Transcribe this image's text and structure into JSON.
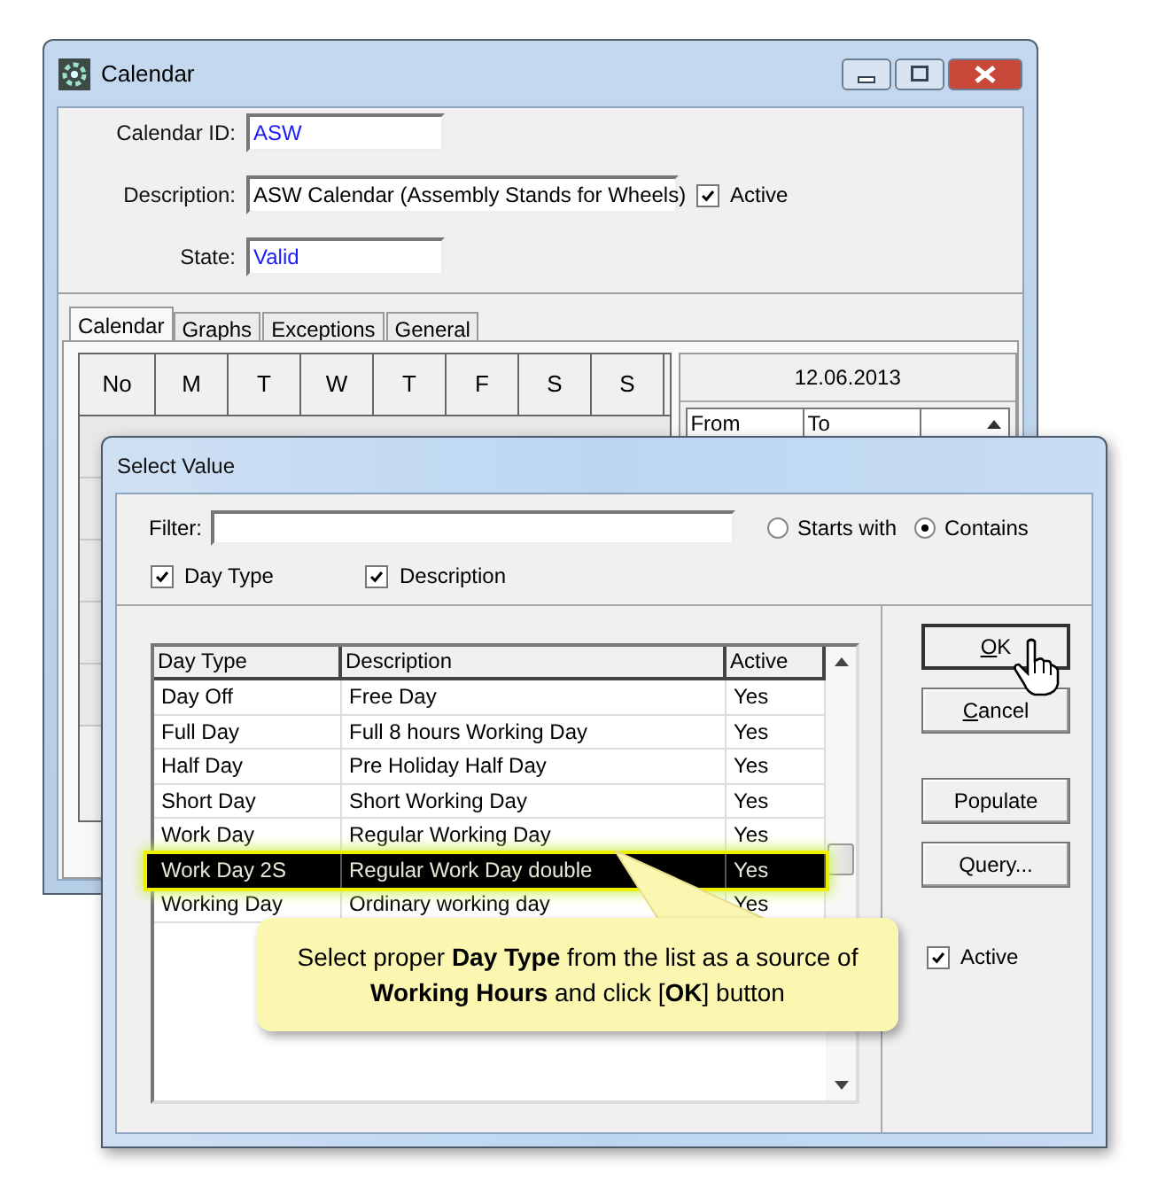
{
  "calendar_window": {
    "title": "Calendar",
    "fields": [
      {
        "label": "Calendar ID:",
        "value": "ASW",
        "kind": "code"
      },
      {
        "label": "Description:",
        "value": "ASW Calendar (Assembly Stands for Wheels)",
        "kind": "text"
      },
      {
        "label": "State:",
        "value": "Valid",
        "kind": "code"
      }
    ],
    "active_checkbox": {
      "label": "Active",
      "checked": true
    },
    "tabs": [
      {
        "label": "Calendar",
        "selected": true
      },
      {
        "label": "Graphs",
        "selected": false
      },
      {
        "label": "Exceptions",
        "selected": false
      },
      {
        "label": "General",
        "selected": false
      }
    ],
    "grid": {
      "columns": [
        "No",
        "M",
        "T",
        "W",
        "T",
        "F",
        "S",
        "S"
      ]
    },
    "date_panel": {
      "date": "12.06.2013",
      "columns": [
        "From",
        "To"
      ]
    }
  },
  "dialog": {
    "title": "Select Value",
    "filter": {
      "label": "Filter:"
    },
    "match_options": [
      {
        "label": "Starts with",
        "selected": false
      },
      {
        "label": "Contains",
        "selected": true
      }
    ],
    "search_in": [
      {
        "label": "Day Type",
        "checked": true
      },
      {
        "label": "Description",
        "checked": true
      }
    ],
    "list": {
      "columns": [
        "Day Type",
        "Description",
        "Active"
      ],
      "rows": [
        {
          "cells": [
            "Day Off",
            "Free Day",
            "Yes"
          ],
          "selected": false
        },
        {
          "cells": [
            "Full Day",
            "Full 8 hours Working Day",
            "Yes"
          ],
          "selected": false
        },
        {
          "cells": [
            "Half Day",
            "Pre Holiday Half Day",
            "Yes"
          ],
          "selected": false
        },
        {
          "cells": [
            "Short Day",
            "Short Working Day",
            "Yes"
          ],
          "selected": false
        },
        {
          "cells": [
            "Work Day",
            "Regular Working Day",
            "Yes"
          ],
          "selected": false
        },
        {
          "cells": [
            "Work Day 2S",
            "Regular Work Day double",
            "Yes"
          ],
          "selected": true
        },
        {
          "cells": [
            "Working Day",
            "Ordinary working day",
            "Yes"
          ],
          "selected": false
        }
      ]
    },
    "buttons": [
      {
        "label": "OK",
        "mnemonic": true,
        "default": true
      },
      {
        "label": "Cancel",
        "mnemonic": true,
        "default": false
      },
      {
        "label": "Populate",
        "mnemonic": false,
        "default": false
      },
      {
        "label": "Query...",
        "mnemonic": false,
        "default": false
      }
    ],
    "active_checkbox": {
      "label": "Active",
      "checked": true
    }
  },
  "callout": {
    "text": "Select proper **Day Type** from the list as a source of **Working Hours** and click [**OK**] button"
  }
}
